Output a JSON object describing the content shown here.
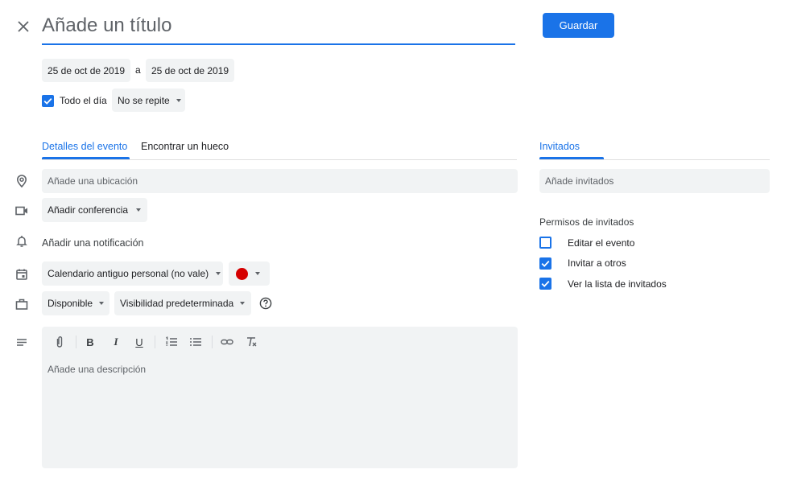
{
  "header": {
    "title_placeholder": "Añade un título",
    "save_label": "Guardar"
  },
  "dates": {
    "start": "25 de oct de 2019",
    "separator": "a",
    "end": "25 de oct de 2019",
    "all_day_label": "Todo el día",
    "all_day_checked": true,
    "repeat": "No se repite"
  },
  "tabs": {
    "details": "Detalles del evento",
    "find_slot": "Encontrar un hueco",
    "guests": "Invitados"
  },
  "details": {
    "location_placeholder": "Añade una ubicación",
    "conference": "Añadir conferencia",
    "notification": "Añadir una notificación",
    "calendar": "Calendario antiguo personal (no vale)",
    "event_color": "#d50000",
    "availability": "Disponible",
    "visibility": "Visibilidad predeterminada",
    "description_placeholder": "Añade una descripción"
  },
  "guests": {
    "add_placeholder": "Añade invitados",
    "permissions_title": "Permisos de invitados",
    "permissions": [
      {
        "label": "Editar el evento",
        "checked": false
      },
      {
        "label": "Invitar a otros",
        "checked": true
      },
      {
        "label": "Ver la lista de invitados",
        "checked": true
      }
    ]
  },
  "colors": {
    "accent": "#1a73e8",
    "field_bg": "#f1f3f4"
  }
}
